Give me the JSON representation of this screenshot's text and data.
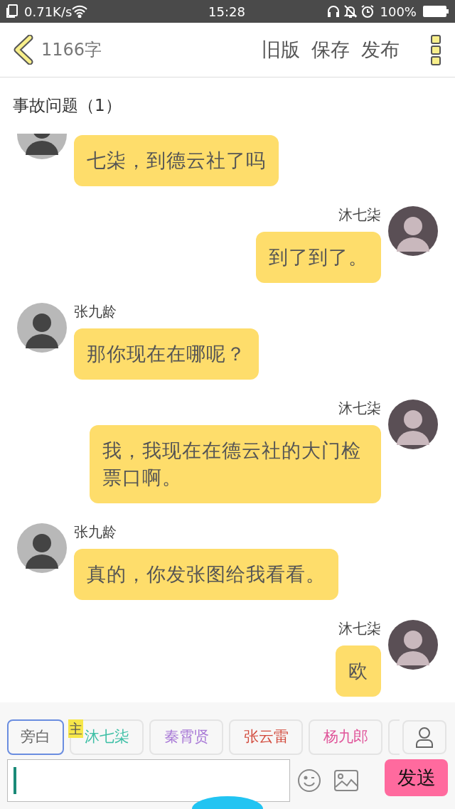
{
  "status_bar": {
    "speed": "0.71K/s",
    "time": "15:28",
    "battery": "100%"
  },
  "header": {
    "word_count": "1166字",
    "actions": [
      "旧版",
      "保存",
      "发布"
    ]
  },
  "section_title": "事故问题（1）",
  "messages": [
    {
      "kind": "incoming",
      "text": "七柒，到德云社了吗"
    },
    {
      "kind": "outgoing",
      "sender": "沐七柒",
      "text": "到了到了。"
    },
    {
      "kind": "incoming",
      "sender": "张九龄",
      "text": "那你现在在哪呢？"
    },
    {
      "kind": "outgoing",
      "sender": "沐七柒",
      "text": "我，我现在在德云社的大门检票口啊。"
    },
    {
      "kind": "incoming",
      "sender": "张九龄",
      "text": "真的，你发张图给我看看。"
    },
    {
      "kind": "outgoing",
      "sender": "沐七柒",
      "text": "欧"
    }
  ],
  "roles": [
    {
      "label": "旁白",
      "selected": true
    },
    {
      "label": "沐七柒",
      "selected": false,
      "color": "#3cbfa5",
      "badge": "主"
    },
    {
      "label": "秦霄贤",
      "selected": false,
      "color": "#a878d6"
    },
    {
      "label": "张云雷",
      "selected": false,
      "color": "#d24a3c"
    },
    {
      "label": "杨九郎",
      "selected": false,
      "color": "#e0559a"
    }
  ],
  "send_button": "发送"
}
